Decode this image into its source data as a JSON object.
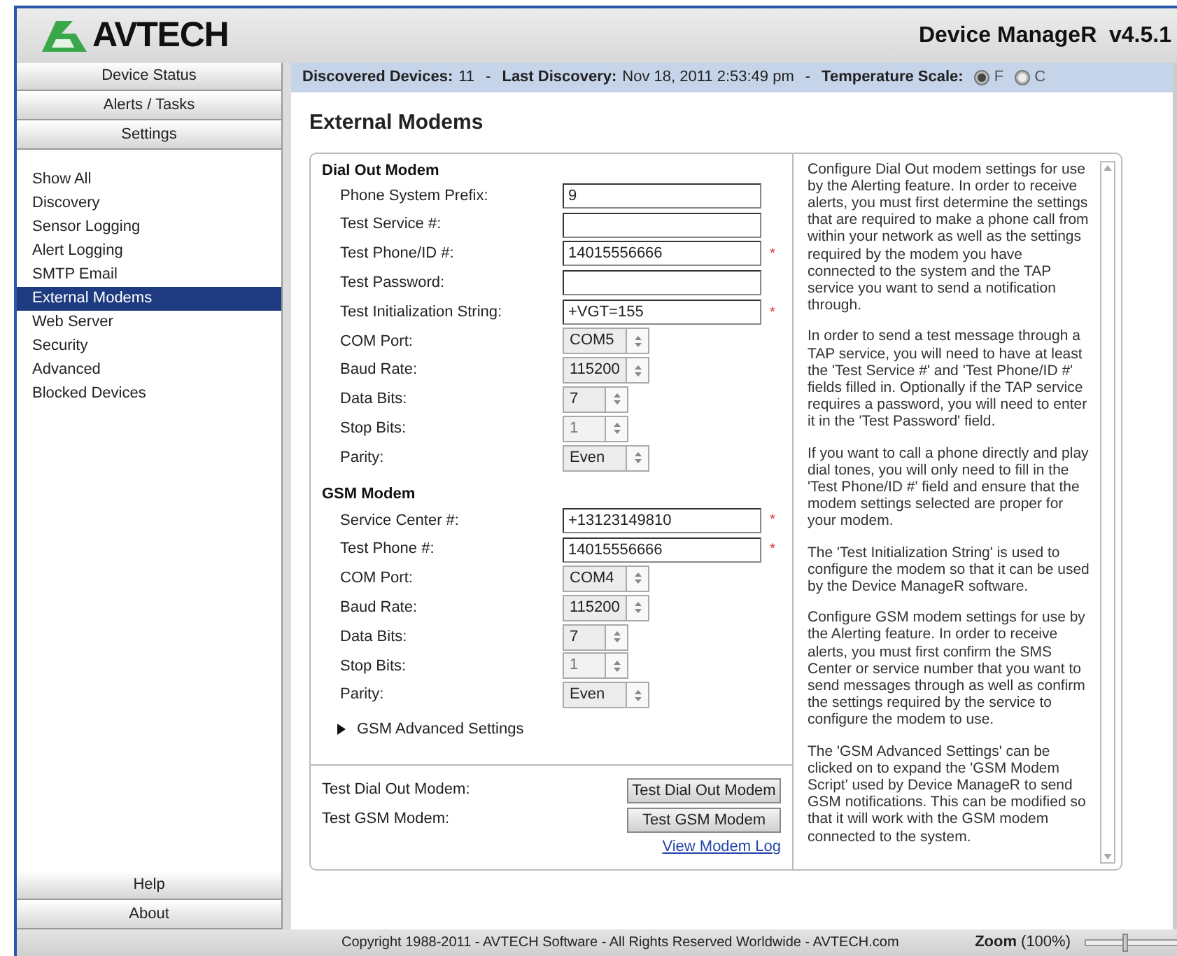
{
  "header": {
    "logo": "AVTECH",
    "app_title": "Device ManageR  v4.5.1"
  },
  "nav": {
    "top_buttons": [
      "Device Status",
      "Alerts / Tasks",
      "Settings"
    ],
    "items": [
      {
        "label": "Show All",
        "selected": false
      },
      {
        "label": "Discovery",
        "selected": false
      },
      {
        "label": "Sensor Logging",
        "selected": false
      },
      {
        "label": "Alert Logging",
        "selected": false
      },
      {
        "label": "SMTP Email",
        "selected": false
      },
      {
        "label": "External Modems",
        "selected": true
      },
      {
        "label": "Web Server",
        "selected": false
      },
      {
        "label": "Security",
        "selected": false
      },
      {
        "label": "Advanced",
        "selected": false
      },
      {
        "label": "Blocked Devices",
        "selected": false
      }
    ],
    "bottom_buttons": [
      "Help",
      "About"
    ]
  },
  "info_bar": {
    "discovered_label": "Discovered Devices:",
    "discovered_value": "11",
    "separator": "-",
    "last_label": "Last Discovery:",
    "last_value": "Nov 18, 2011  2:53:49 pm",
    "temp_label": "Temperature Scale:",
    "options": [
      {
        "label": "F",
        "selected": true
      },
      {
        "label": "C",
        "selected": false
      }
    ]
  },
  "page_title": "External Modems",
  "sections": [
    {
      "title": "Dial Out Modem",
      "fields": [
        {
          "kind": "text",
          "label": "Phone System Prefix:",
          "value": "9",
          "required": false
        },
        {
          "kind": "text",
          "label": "Test Service #:",
          "required": false
        },
        {
          "kind": "text",
          "label": "Test Phone/ID #:",
          "value": "14015556666",
          "required": true
        },
        {
          "kind": "text",
          "label": "Test Password:",
          "required": false
        },
        {
          "kind": "text",
          "label": "Test Initialization String:",
          "value": "+VGT=155",
          "required": true
        },
        {
          "kind": "select",
          "label": "COM Port:",
          "value": "COM5",
          "disabled": false
        },
        {
          "kind": "select",
          "label": "Baud Rate:",
          "value": "115200",
          "disabled": false
        },
        {
          "kind": "select",
          "label": "Data Bits:",
          "value": "7",
          "disabled": false
        },
        {
          "kind": "select",
          "label": "Stop Bits:",
          "value": "1",
          "disabled": true
        },
        {
          "kind": "select",
          "label": "Parity:",
          "value": "Even",
          "disabled": false
        }
      ]
    },
    {
      "title": "GSM Modem",
      "fields": [
        {
          "kind": "text",
          "label": "Service Center #:",
          "value": "+13123149810",
          "required": true
        },
        {
          "kind": "text",
          "label": "Test Phone #:",
          "value": "14015556666",
          "required": true
        },
        {
          "kind": "select",
          "label": "COM Port:",
          "value": "COM4",
          "disabled": false
        },
        {
          "kind": "select",
          "label": "Baud Rate:",
          "value": "115200",
          "disabled": false
        },
        {
          "kind": "select",
          "label": "Data Bits:",
          "value": "7",
          "disabled": false
        },
        {
          "kind": "select",
          "label": "Stop Bits:",
          "value": "1",
          "disabled": true
        },
        {
          "kind": "select",
          "label": "Parity:",
          "value": "Even",
          "disabled": false
        }
      ]
    }
  ],
  "advanced": {
    "label": "GSM Advanced Settings",
    "expanded": false
  },
  "required_mark": "*",
  "tests": [
    {
      "label": "Test Dial Out Modem:",
      "button": "Test Dial Out Modem"
    },
    {
      "label": "Test GSM Modem:",
      "button": "Test GSM Modem"
    }
  ],
  "log_link": "View Modem Log",
  "help": [
    "Configure Dial Out modem settings for use by the Alerting feature. In order to receive alerts, you must first determine the settings that are required to make a phone call from within your network as well as the settings required by the modem you have connected to the system and the TAP service you want to send a notification through.",
    "In order to send a test message through a TAP service, you will need to have at least the 'Test Service #' and 'Test Phone/ID #' fields filled in. Optionally if the TAP service requires a password, you will need to enter it in the 'Test Password' field.",
    "If you want to call a phone directly and play dial tones, you will only need to fill in the 'Test Phone/ID #' field and ensure that the modem settings selected are proper for your modem.",
    "The 'Test Initialization String' is used to configure the modem so that it can be used by the Device ManageR software.",
    "Configure GSM modem settings for use by the Alerting feature. In order to receive alerts, you must first confirm the SMS Center or service number that you want to send messages through as well as confirm the settings required by the service to configure the modem to use.",
    "The 'GSM Advanced Settings' can be clicked on to expand the 'GSM Modem Script' used by Device ManageR to send GSM notifications. This can be modified so that it will work with the GSM modem connected to the system."
  ],
  "footer": {
    "copyright": "Copyright 1988-2011 - AVTECH Software - All Rights Reserved Worldwide - AVTECH.com",
    "zoom_label": "Zoom",
    "zoom_value": "(100%)",
    "zoom_slider": {
      "level": 0.4
    }
  }
}
